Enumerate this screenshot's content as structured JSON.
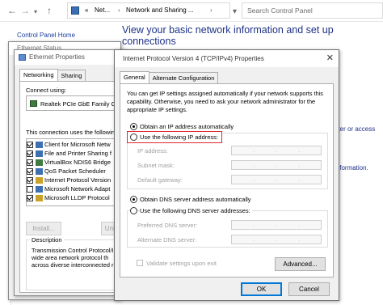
{
  "control_panel": {
    "breadcrumb": [
      "Net...",
      "Network and Sharing ..."
    ],
    "breadcrumb_prefix": "«",
    "search_placeholder": "Search Control Panel",
    "home_link": "Control Panel Home",
    "heading": "View your basic network information and set up connections",
    "right_text_1": "uter or access",
    "right_text_2": "information."
  },
  "ethernet_status": {
    "title": "Ethernet Status"
  },
  "ethernet_properties": {
    "title": "Ethernet Properties",
    "tabs": [
      "Networking",
      "Sharing"
    ],
    "connect_using_label": "Connect using:",
    "adapter": "Realtek PCIe GbE Family C",
    "items_label": "This connection uses the following",
    "items": [
      {
        "label": "Client for Microsoft Netw",
        "checked": true
      },
      {
        "label": "File and Printer Sharing fo",
        "checked": true
      },
      {
        "label": "VirtualBox NDIS6 Bridge",
        "checked": true
      },
      {
        "label": "QoS Packet Scheduler",
        "checked": true
      },
      {
        "label": "Internet Protocol Version",
        "checked": true
      },
      {
        "label": "Microsoft Network Adapt",
        "checked": false
      },
      {
        "label": "Microsoft LLDP Protocol",
        "checked": true
      }
    ],
    "install_button": "Install...",
    "uninstall_button": "Unin",
    "description_label": "Description",
    "description_text": "Transmission Control Protocol/I wide area network protocol th across diverse interconnected r"
  },
  "ipv4": {
    "title": "Internet Protocol Version 4 (TCP/IPv4) Properties",
    "tabs": [
      "General",
      "Alternate Configuration"
    ],
    "intro": "You can get IP settings assigned automatically if your network supports this capability. Otherwise, you need to ask your network administrator for the appropriate IP settings.",
    "obtain_ip_auto": "Obtain an IP address automatically",
    "use_following_ip": "Use the following IP address:",
    "ip_address_label": "IP address:",
    "subnet_mask_label": "Subnet mask:",
    "default_gateway_label": "Default gateway:",
    "obtain_dns_auto": "Obtain DNS server address automatically",
    "use_following_dns": "Use the following DNS server addresses:",
    "preferred_dns_label": "Preferred DNS server:",
    "alternate_dns_label": "Alternate DNS server:",
    "validate_label": "Validate settings upon exit",
    "advanced_button": "Advanced...",
    "ok_button": "OK",
    "cancel_button": "Cancel",
    "ip_selected": "auto",
    "dns_selected": "auto",
    "highlight_color": "#e0262e"
  }
}
